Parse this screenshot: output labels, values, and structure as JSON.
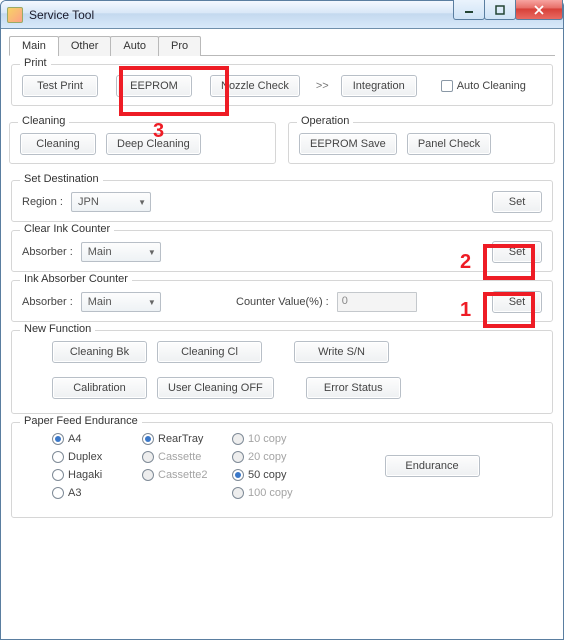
{
  "window": {
    "title": "Service Tool",
    "controls": {
      "minimize": "–",
      "maximize": "▭",
      "close": "✕"
    }
  },
  "tabs": [
    "Main",
    "Other",
    "Auto",
    "Pro"
  ],
  "active_tab": "Main",
  "print": {
    "legend": "Print",
    "test_print": "Test Print",
    "eeprom": "EEPROM",
    "nozzle_check": "Nozzle Check",
    "integration": "Integration",
    "auto_cleaning": "Auto Cleaning"
  },
  "cleaning": {
    "legend": "Cleaning",
    "cleaning": "Cleaning",
    "deep_cleaning": "Deep Cleaning"
  },
  "operation": {
    "legend": "Operation",
    "eeprom_save": "EEPROM Save",
    "panel_check": "Panel Check"
  },
  "set_destination": {
    "legend": "Set Destination",
    "region_label": "Region :",
    "region_value": "JPN",
    "set": "Set"
  },
  "clear_ink": {
    "legend": "Clear Ink Counter",
    "absorber_label": "Absorber :",
    "absorber_value": "Main",
    "set": "Set"
  },
  "ink_absorber": {
    "legend": "Ink Absorber Counter",
    "absorber_label": "Absorber :",
    "absorber_value": "Main",
    "counter_label": "Counter Value(%) :",
    "counter_value": "0",
    "set": "Set"
  },
  "new_function": {
    "legend": "New Function",
    "cleaning_bk": "Cleaning Bk",
    "cleaning_cl": "Cleaning Cl",
    "write_sn": "Write S/N",
    "calibration": "Calibration",
    "user_cleaning_off": "User Cleaning OFF",
    "error_status": "Error Status"
  },
  "paper_feed": {
    "legend": "Paper Feed Endurance",
    "col1": [
      "A4",
      "Duplex",
      "Hagaki",
      "A3"
    ],
    "col1_selected": 0,
    "col2": [
      "RearTray",
      "Cassette",
      "Cassette2"
    ],
    "col2_selected": 0,
    "col3": [
      "10 copy",
      "20 copy",
      "50 copy",
      "100 copy"
    ],
    "col3_selected": 2,
    "endurance": "Endurance"
  },
  "annotations": {
    "1": "1",
    "2": "2",
    "3": "3"
  }
}
